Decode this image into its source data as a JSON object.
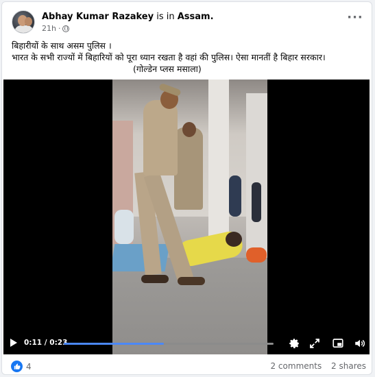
{
  "post": {
    "author": "Abhay Kumar Razakey",
    "is_in": "is in",
    "place": "Assam.",
    "time": "21h",
    "more_icon": "more-horizontal-icon",
    "privacy_icon": "globe-icon"
  },
  "text": {
    "line1": "बिहारीयों के साथ असम पुलिस ।",
    "line2": "भारत के सभी राज्यों में बिहारियों को पूरा ध्यान रखता है वहां की पुलिस। ऐसा मानतीं है बिहार सरकार।",
    "line3": "(गोल्डेन प्लस मसाला)"
  },
  "video": {
    "time_display": "0:11 / 0:23",
    "progress": 0.478,
    "progress_color": "#4b88f7",
    "icons": [
      "play-icon",
      "settings-icon",
      "expand-icon",
      "picture-in-picture-icon",
      "volume-icon"
    ]
  },
  "footer": {
    "reaction_icon": "like-icon",
    "reaction_count": "4",
    "comments": "2 comments",
    "shares": "2 shares"
  },
  "colors": {
    "accent": "#1877f2",
    "secondary_text": "#65676b"
  }
}
